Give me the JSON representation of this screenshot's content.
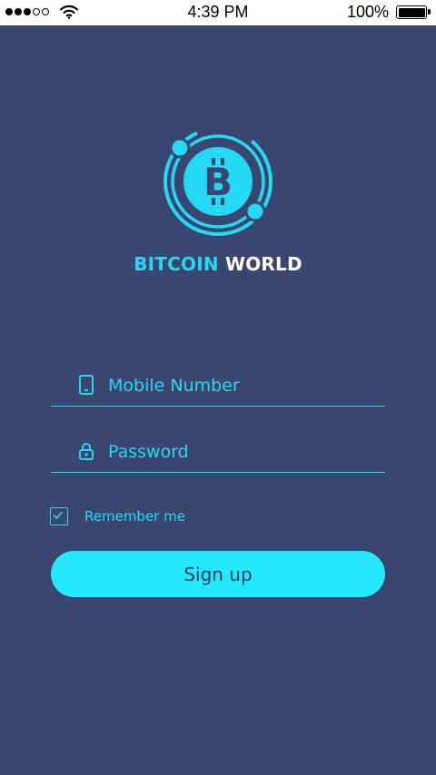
{
  "status_bar": {
    "time": "4:39 PM",
    "battery_percent": "100%",
    "signal_bars_filled": 3,
    "signal_bars_total": 5
  },
  "brand": {
    "name_part1": "BITCOIN",
    "name_part2": "WORLD",
    "logo_icon": "bitcoin-orbit-icon",
    "logo_glyph": "B"
  },
  "form": {
    "mobile": {
      "placeholder": "Mobile Number",
      "value": "",
      "icon": "phone-icon"
    },
    "password": {
      "placeholder": "Password",
      "value": "",
      "icon": "lock-icon"
    },
    "remember_label": "Remember me",
    "remember_checked": true,
    "signup_label": "Sign up"
  },
  "colors": {
    "background": "#3b4670",
    "accent": "#24d9f3",
    "button": "#24e8fb",
    "button_text": "#2c3a63"
  }
}
